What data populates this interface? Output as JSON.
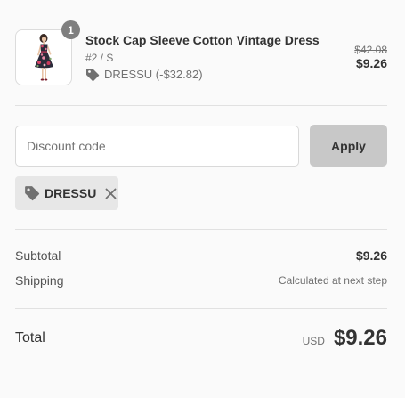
{
  "product": {
    "quantity": "1",
    "title": "Stock Cap Sleeve Cotton Vintage Dress",
    "variant": "#2 / S",
    "discount_note": "DRESSU (-$32.82)",
    "original_price": "$42.08",
    "price": "$9.26"
  },
  "discount": {
    "placeholder": "Discount code",
    "value": "",
    "apply_label": "Apply",
    "applied_code": "DRESSU"
  },
  "summary": {
    "subtotal_label": "Subtotal",
    "subtotal_value": "$9.26",
    "shipping_label": "Shipping",
    "shipping_value": "Calculated at next step",
    "total_label": "Total",
    "currency": "USD",
    "total_value": "$9.26"
  },
  "icons": {
    "tag": "tag-icon",
    "close": "close-icon"
  },
  "colors": {
    "background": "#fafafa",
    "badge": "#7f7f7f",
    "apply_button": "#c8c8c8",
    "applied_tag_bg": "#e7e7e7"
  }
}
